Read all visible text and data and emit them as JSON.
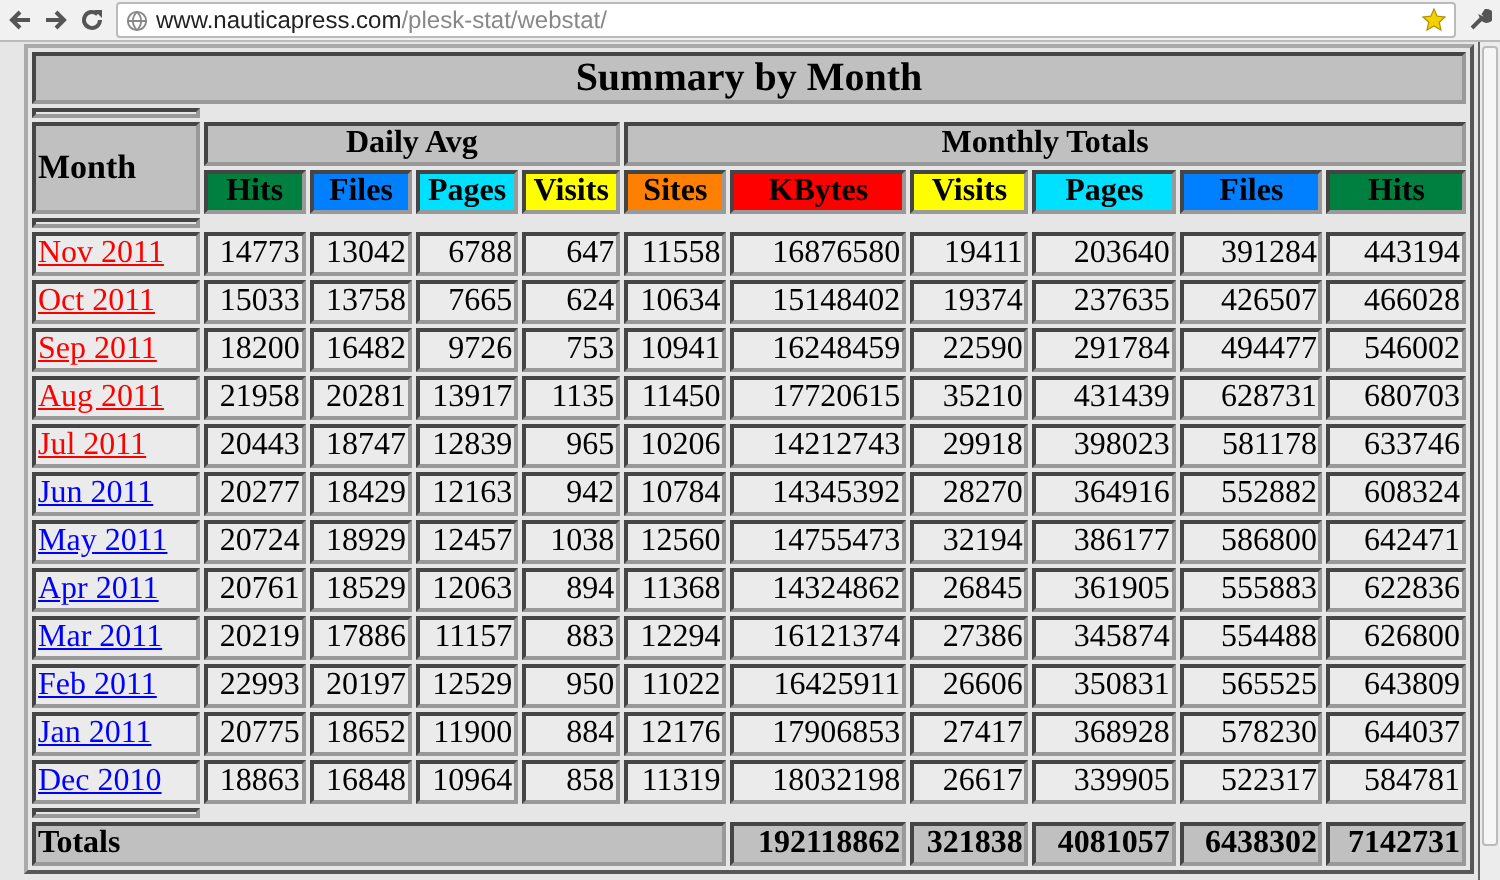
{
  "browser": {
    "url_host": "www.nauticapress.com",
    "url_path": "/plesk-stat/webstat/"
  },
  "table": {
    "title": "Summary by Month",
    "month_header": "Month",
    "groups": [
      {
        "label": "Daily Avg",
        "columns": [
          {
            "label": "Hits",
            "color": "#008040"
          },
          {
            "label": "Files",
            "color": "#0080ff"
          },
          {
            "label": "Pages",
            "color": "#00e0ff"
          },
          {
            "label": "Visits",
            "color": "#ffff00"
          }
        ]
      },
      {
        "label": "Monthly Totals",
        "columns": [
          {
            "label": "Sites",
            "color": "#ff8000"
          },
          {
            "label": "KBytes",
            "color": "#ff0000"
          },
          {
            "label": "Visits",
            "color": "#ffff00"
          },
          {
            "label": "Pages",
            "color": "#00e0ff"
          },
          {
            "label": "Files",
            "color": "#0080ff"
          },
          {
            "label": "Hits",
            "color": "#008040"
          }
        ]
      }
    ],
    "rows": [
      {
        "month": "Nov 2011",
        "visited": true,
        "values": [
          "14773",
          "13042",
          "6788",
          "647",
          "11558",
          "16876580",
          "19411",
          "203640",
          "391284",
          "443194"
        ]
      },
      {
        "month": "Oct 2011",
        "visited": true,
        "values": [
          "15033",
          "13758",
          "7665",
          "624",
          "10634",
          "15148402",
          "19374",
          "237635",
          "426507",
          "466028"
        ]
      },
      {
        "month": "Sep 2011",
        "visited": true,
        "values": [
          "18200",
          "16482",
          "9726",
          "753",
          "10941",
          "16248459",
          "22590",
          "291784",
          "494477",
          "546002"
        ]
      },
      {
        "month": "Aug 2011",
        "visited": true,
        "values": [
          "21958",
          "20281",
          "13917",
          "1135",
          "11450",
          "17720615",
          "35210",
          "431439",
          "628731",
          "680703"
        ]
      },
      {
        "month": "Jul 2011",
        "visited": true,
        "values": [
          "20443",
          "18747",
          "12839",
          "965",
          "10206",
          "14212743",
          "29918",
          "398023",
          "581178",
          "633746"
        ]
      },
      {
        "month": "Jun 2011",
        "visited": false,
        "values": [
          "20277",
          "18429",
          "12163",
          "942",
          "10784",
          "14345392",
          "28270",
          "364916",
          "552882",
          "608324"
        ]
      },
      {
        "month": "May 2011",
        "visited": false,
        "values": [
          "20724",
          "18929",
          "12457",
          "1038",
          "12560",
          "14755473",
          "32194",
          "386177",
          "586800",
          "642471"
        ]
      },
      {
        "month": "Apr 2011",
        "visited": false,
        "values": [
          "20761",
          "18529",
          "12063",
          "894",
          "11368",
          "14324862",
          "26845",
          "361905",
          "555883",
          "622836"
        ]
      },
      {
        "month": "Mar 2011",
        "visited": false,
        "values": [
          "20219",
          "17886",
          "11157",
          "883",
          "12294",
          "16121374",
          "27386",
          "345874",
          "554488",
          "626800"
        ]
      },
      {
        "month": "Feb 2011",
        "visited": false,
        "values": [
          "22993",
          "20197",
          "12529",
          "950",
          "11022",
          "16425911",
          "26606",
          "350831",
          "565525",
          "643809"
        ]
      },
      {
        "month": "Jan 2011",
        "visited": false,
        "values": [
          "20775",
          "18652",
          "11900",
          "884",
          "12176",
          "17906853",
          "27417",
          "368928",
          "578230",
          "644037"
        ]
      },
      {
        "month": "Dec 2010",
        "visited": false,
        "values": [
          "18863",
          "16848",
          "10964",
          "858",
          "11319",
          "18032198",
          "26617",
          "339905",
          "522317",
          "584781"
        ]
      }
    ],
    "totals": {
      "label": "Totals",
      "values": [
        "192118862",
        "321838",
        "4081057",
        "6438302",
        "7142731"
      ]
    }
  }
}
